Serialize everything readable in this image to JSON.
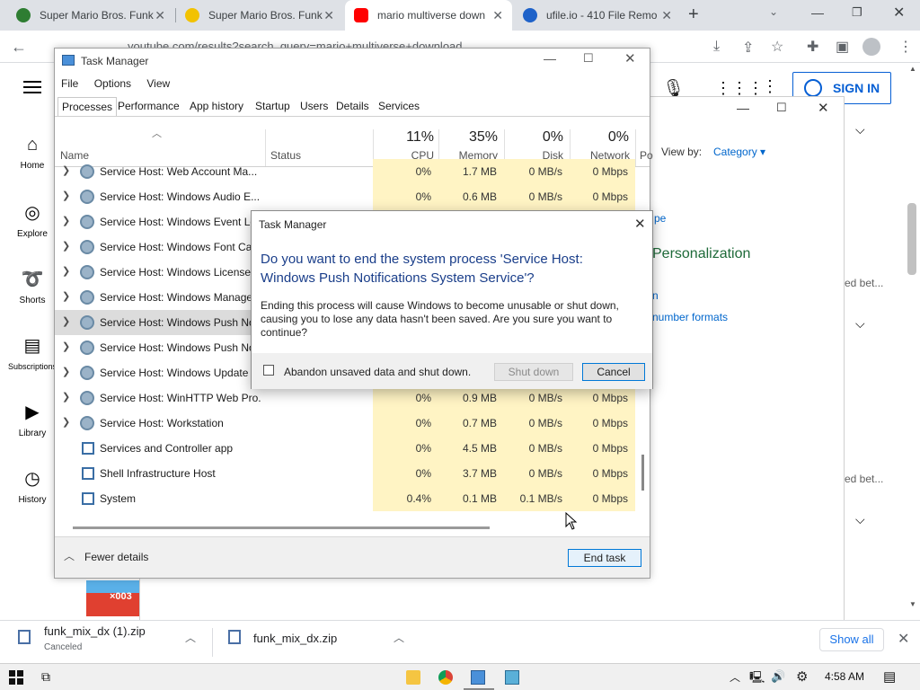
{
  "browser": {
    "tabs": [
      {
        "title": "Super Mario Bros. Funk",
        "favicon_color": "#2e7d32"
      },
      {
        "title": "Super Mario Bros. Funk",
        "favicon_color": "#f2c200"
      },
      {
        "title": "mario multiverse down",
        "favicon_color": "#ff0000"
      },
      {
        "title": "ufile.io - 410 File Remo",
        "favicon_color": "#1e62c9"
      }
    ],
    "new_tab": "+",
    "url": "youtube.com/results?search_query=mario+multiverse+download"
  },
  "youtube": {
    "sign_in": "SIGN IN",
    "nav": [
      {
        "label": "Home",
        "icon": "home-icon"
      },
      {
        "label": "Explore",
        "icon": "compass-icon"
      },
      {
        "label": "Shorts",
        "icon": "shorts-icon"
      },
      {
        "label": "Subscriptions",
        "icon": "subscriptions-icon"
      },
      {
        "label": "Library",
        "icon": "library-icon"
      },
      {
        "label": "History",
        "icon": "history-icon"
      }
    ],
    "side_text_1": "ed bet...",
    "side_text_2": "ed bet..."
  },
  "settings_window": {
    "view_by_label": "View by:",
    "view_by_value": "Category",
    "link_fragment": "pe",
    "heading": "Personalization",
    "link2_prefix": "n",
    "link3": "number formats"
  },
  "task_manager": {
    "title": "Task Manager",
    "menu": [
      "File",
      "Options",
      "View"
    ],
    "tabs": [
      "Processes",
      "Performance",
      "App history",
      "Startup",
      "Users",
      "Details",
      "Services"
    ],
    "active_tab": "Processes",
    "columns": {
      "name": "Name",
      "status": "Status",
      "cpu": {
        "pct": "11%",
        "label": "CPU"
      },
      "memory": {
        "pct": "35%",
        "label": "Memory"
      },
      "disk": {
        "pct": "0%",
        "label": "Disk"
      },
      "network": {
        "pct": "0%",
        "label": "Network"
      },
      "power": "Po"
    },
    "rows": [
      {
        "name": "Service Host: Web Account Ma...",
        "cpu": "0%",
        "mem": "1.7 MB",
        "disk": "0 MB/s",
        "net": "0 Mbps",
        "icon": "gear",
        "expand": true
      },
      {
        "name": "Service Host: Windows Audio E...",
        "cpu": "0%",
        "mem": "0.6 MB",
        "disk": "0 MB/s",
        "net": "0 Mbps",
        "icon": "gear",
        "expand": true
      },
      {
        "name": "Service Host: Windows Event Lo",
        "cpu": "",
        "mem": "",
        "disk": "",
        "net": "",
        "icon": "gear",
        "expand": true
      },
      {
        "name": "Service Host: Windows Font Ca...",
        "cpu": "",
        "mem": "",
        "disk": "",
        "net": "",
        "icon": "gear",
        "expand": true
      },
      {
        "name": "Service Host: Windows License",
        "cpu": "",
        "mem": "",
        "disk": "",
        "net": "",
        "icon": "gear",
        "expand": true
      },
      {
        "name": "Service Host: Windows Manage...",
        "cpu": "",
        "mem": "",
        "disk": "",
        "net": "",
        "icon": "gear",
        "expand": true
      },
      {
        "name": "Service Host: Windows Push No",
        "cpu": "",
        "mem": "",
        "disk": "",
        "net": "",
        "icon": "gear",
        "expand": true,
        "selected": true
      },
      {
        "name": "Service Host: Windows Push No",
        "cpu": "",
        "mem": "",
        "disk": "",
        "net": "",
        "icon": "gear",
        "expand": true
      },
      {
        "name": "Service Host: Windows Update",
        "cpu": "",
        "mem": "",
        "disk": "",
        "net": "",
        "icon": "gear",
        "expand": true
      },
      {
        "name": "Service Host: WinHTTP Web Pro...",
        "cpu": "0%",
        "mem": "0.9 MB",
        "disk": "0 MB/s",
        "net": "0 Mbps",
        "icon": "gear",
        "expand": true
      },
      {
        "name": "Service Host: Workstation",
        "cpu": "0%",
        "mem": "0.7 MB",
        "disk": "0 MB/s",
        "net": "0 Mbps",
        "icon": "gear",
        "expand": true
      },
      {
        "name": "Services and Controller app",
        "cpu": "0%",
        "mem": "4.5 MB",
        "disk": "0 MB/s",
        "net": "0 Mbps",
        "icon": "app",
        "expand": false
      },
      {
        "name": "Shell Infrastructure Host",
        "cpu": "0%",
        "mem": "3.7 MB",
        "disk": "0 MB/s",
        "net": "0 Mbps",
        "icon": "app",
        "expand": false
      },
      {
        "name": "System",
        "cpu": "0.4%",
        "mem": "0.1 MB",
        "disk": "0.1 MB/s",
        "net": "0 Mbps",
        "icon": "app",
        "expand": false
      }
    ],
    "fewer_details": "Fewer details",
    "end_task": "End task"
  },
  "dialog": {
    "title": "Task Manager",
    "question": "Do you want to end the system process 'Service Host: Windows Push Notifications System Service'?",
    "body": "Ending this process will cause Windows to become unusable or shut down, causing you to lose any data hasn't been saved. Are you sure you want to continue?",
    "checkbox_label": "Abandon unsaved data and shut down.",
    "shutdown": "Shut down",
    "cancel": "Cancel"
  },
  "downloads": {
    "items": [
      {
        "name": "funk_mix_dx (1).zip",
        "status": "Canceled"
      },
      {
        "name": "funk_mix_dx.zip",
        "status": ""
      }
    ],
    "show_all": "Show all"
  },
  "thumbnail": {
    "overlay_text": "×003"
  },
  "taskbar": {
    "time": "4:58 AM"
  }
}
